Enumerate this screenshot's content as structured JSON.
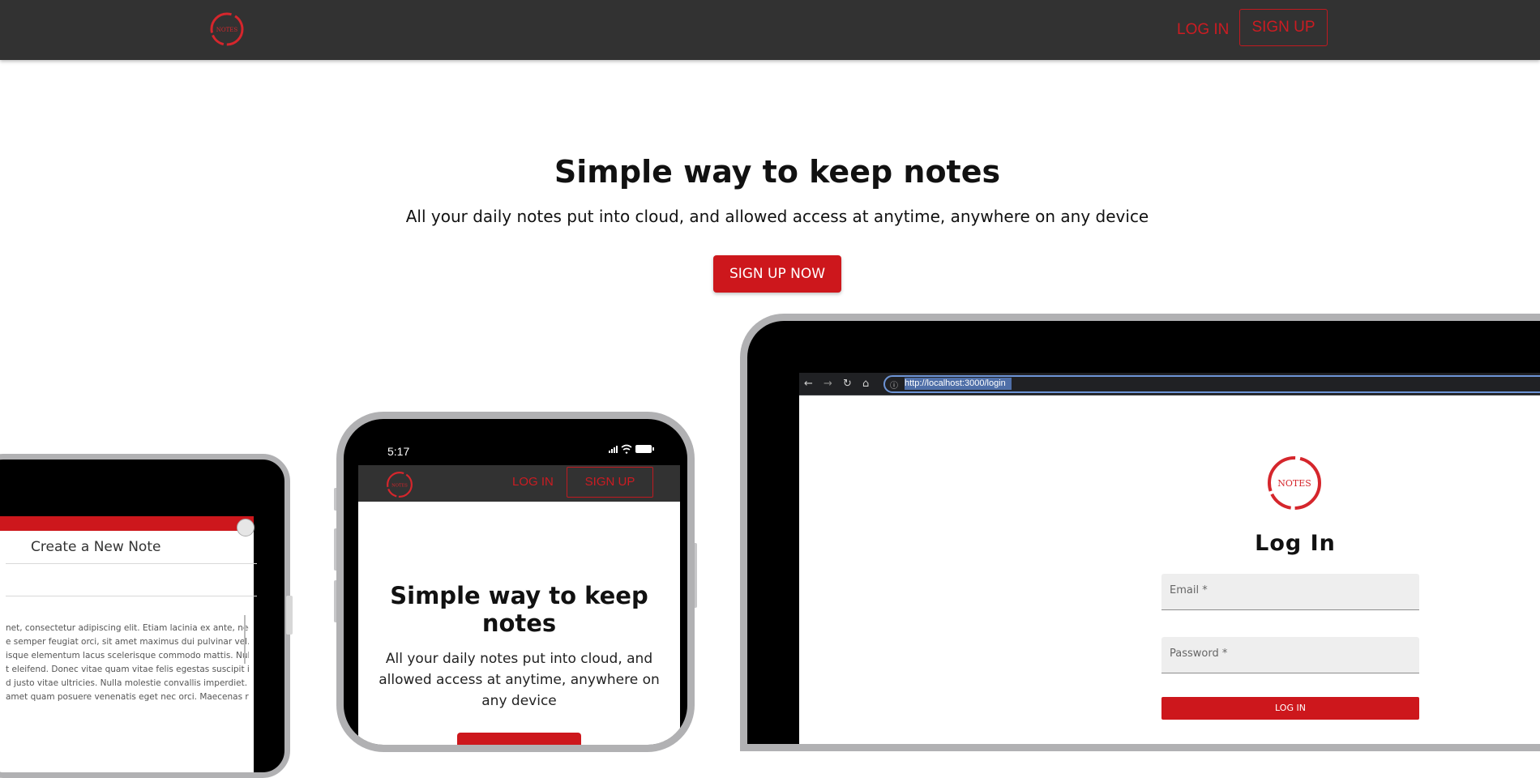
{
  "header": {
    "logo_text": "NOTES",
    "login_label": "LOG IN",
    "signup_label": "SIGN UP"
  },
  "hero": {
    "title": "Simple way to keep notes",
    "subtitle": "All your daily notes put into cloud, and allowed access at anytime, anywhere on any device",
    "cta_label": "SIGN UP NOW"
  },
  "tablet": {
    "heading": "Create a New Note",
    "body_lines": [
      "net, consectetur adipiscing elit. Etiam lacinia ex ante, nec viverra",
      "e semper feugiat orci, sit amet maximus dui pulvinar vel. In luctus",
      "isque elementum lacus scelerisque commodo mattis. Nulla",
      "t eleifend. Donec vitae quam vitae felis egestas suscipit in eu",
      "d justo vitae ultricies. Nulla molestie convallis imperdiet.",
      "amet quam posuere venenatis eget nec orci. Maecenas rhoncus"
    ]
  },
  "phone": {
    "time": "5:17",
    "logo_text": "NOTES",
    "login_label": "LOG IN",
    "signup_label": "SIGN UP",
    "title": "Simple way to keep notes",
    "subtitle": "All your daily notes put into cloud, and allowed access at anytime, anywhere on any device"
  },
  "laptop": {
    "url": "http://localhost:3000/login",
    "logo_text": "NOTES",
    "login_title": "Log In",
    "email_placeholder": "Email *",
    "password_placeholder": "Password *",
    "login_button": "LOG IN"
  },
  "colors": {
    "brand_red": "#cd171c",
    "nav_bg": "#323232",
    "device_bezel": "#b1b1b3"
  },
  "icons": {
    "logo": "notes-circle-logo",
    "browser": [
      "back-arrow-icon",
      "forward-arrow-icon",
      "reload-icon",
      "home-icon",
      "info-icon"
    ],
    "phone_status": [
      "signal-icon",
      "wifi-icon",
      "battery-icon"
    ]
  }
}
